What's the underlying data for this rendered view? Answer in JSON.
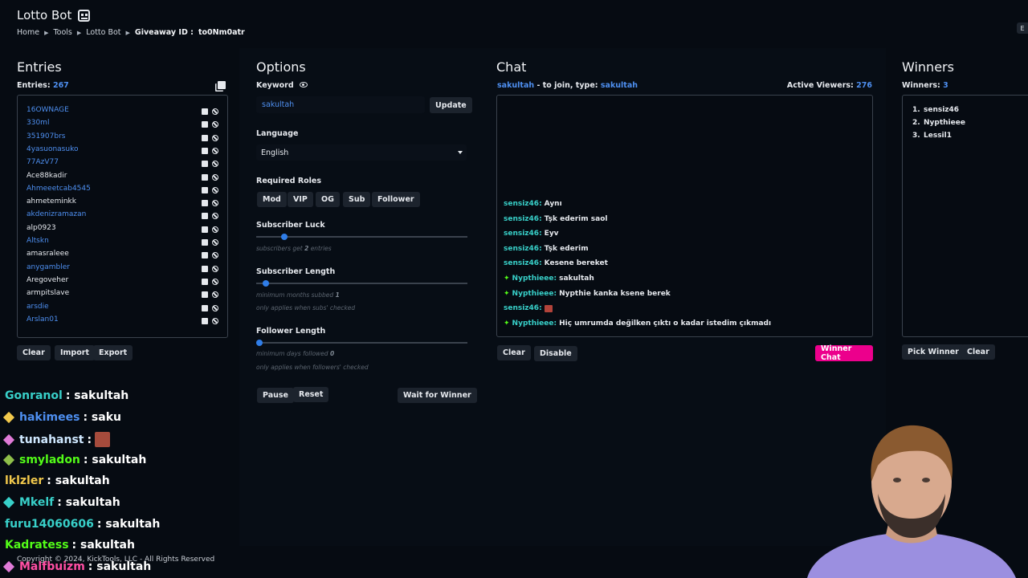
{
  "header": {
    "app_title": "Lotto Bot",
    "breadcrumb": [
      "Home",
      "Tools",
      "Lotto Bot"
    ],
    "giveaway_label": "Giveaway ID :",
    "giveaway_id": "to0Nm0atr",
    "corner_label": "E"
  },
  "entries": {
    "title": "Entries",
    "count_label": "Entries:",
    "count": "267",
    "items": [
      {
        "name": "16OWNAGE",
        "color": "#4e8ff0"
      },
      {
        "name": "330ml",
        "color": "#4e8ff0"
      },
      {
        "name": "351907brs",
        "color": "#4e8ff0"
      },
      {
        "name": "4yasuonasuko",
        "color": "#4e8ff0"
      },
      {
        "name": "77AzV77",
        "color": "#4e8ff0"
      },
      {
        "name": "Ace88kadir",
        "color": "#e6e9ee"
      },
      {
        "name": "Ahmeeetcab4545",
        "color": "#4e8ff0"
      },
      {
        "name": "ahmeteminkk",
        "color": "#e6e9ee"
      },
      {
        "name": "akdenizramazan",
        "color": "#4e8ff0"
      },
      {
        "name": "alp0923",
        "color": "#e6e9ee"
      },
      {
        "name": "Altskn",
        "color": "#4e8ff0"
      },
      {
        "name": "amasraleee",
        "color": "#e6e9ee"
      },
      {
        "name": "anygambler",
        "color": "#4e8ff0"
      },
      {
        "name": "Aregoveher",
        "color": "#e6e9ee"
      },
      {
        "name": "armpitslave",
        "color": "#e6e9ee"
      },
      {
        "name": "arsdie",
        "color": "#4e8ff0"
      },
      {
        "name": "Arslan01",
        "color": "#4e8ff0"
      }
    ],
    "buttons": {
      "clear": "Clear",
      "import": "Import",
      "export": "Export"
    }
  },
  "options": {
    "title": "Options",
    "keyword_label": "Keyword",
    "keyword_value": "sakultah",
    "update_label": "Update",
    "language_label": "Language",
    "language_value": "English",
    "roles_label": "Required Roles",
    "roles": [
      "Mod",
      "VIP",
      "OG",
      "Sub",
      "Follower"
    ],
    "sub_luck_label": "Subscriber Luck",
    "sub_luck_hint_pre": "subscribers get",
    "sub_luck_hint_value": "2",
    "sub_luck_hint_post": "entries",
    "sub_luck_level": 0.12,
    "sub_length_label": "Subscriber Length",
    "sub_length_hint_pre": "minimum months subbed",
    "sub_length_hint_value": "1",
    "sub_length_hint2": "only applies when subs' checked",
    "sub_length_level": 0.03,
    "follower_length_label": "Follower Length",
    "follower_length_hint_pre": "minimum days followed",
    "follower_length_hint_value": "0",
    "follower_length_hint2": "only applies when followers' checked",
    "follower_length_level": 0,
    "buttons": {
      "pause": "Pause",
      "reset": "Reset",
      "wait": "Wait for Winner"
    }
  },
  "chat": {
    "title": "Chat",
    "join_user": "sakultah",
    "join_text": "- to join, type:",
    "join_keyword": "sakultah",
    "viewers_label": "Active Viewers:",
    "viewers_count": "276",
    "messages": [
      {
        "badge": false,
        "user": "sensiz46:",
        "text": "Aynı",
        "emote": false
      },
      {
        "badge": false,
        "user": "sensiz46:",
        "text": "Tşk ederim saol",
        "emote": false
      },
      {
        "badge": false,
        "user": "sensiz46:",
        "text": "Eyv",
        "emote": false
      },
      {
        "badge": false,
        "user": "sensiz46:",
        "text": "Tşk ederim",
        "emote": false
      },
      {
        "badge": false,
        "user": "sensiz46:",
        "text": "Kesene bereket",
        "emote": false
      },
      {
        "badge": true,
        "user": "Nypthieee:",
        "text": "sakultah",
        "emote": false
      },
      {
        "badge": true,
        "user": "Nypthieee:",
        "text": "Nypthie kanka ksene berek",
        "emote": false
      },
      {
        "badge": false,
        "user": "sensiz46:",
        "text": "",
        "emote": true
      },
      {
        "badge": true,
        "user": "Nypthieee:",
        "text": "Hiç umrumda değilken çıktı o kadar istedim çıkmadı",
        "emote": false
      }
    ],
    "buttons": {
      "clear": "Clear",
      "disable": "Disable",
      "winner_chat": "Winner Chat"
    }
  },
  "winners": {
    "title": "Winners",
    "count_label": "Winners:",
    "count": "3",
    "items": [
      "sensiz46",
      "Nypthieee",
      "Lessil1"
    ],
    "buttons": {
      "pick": "Pick Winner",
      "clear": "Clear"
    }
  },
  "overlay_chat": [
    {
      "user": "Gonranol",
      "text": ": sakultah",
      "user_color": "#38d0c9",
      "badge_color": "",
      "emote": false
    },
    {
      "user": "hakimees",
      "text": ": saku",
      "user_color": "#4e8ff0",
      "badge_color": "#f2c94c",
      "emote": false
    },
    {
      "user": "tunahanst",
      "text": ":",
      "user_color": "#cfe8ff",
      "badge_color": "#e07bd8",
      "emote": true
    },
    {
      "user": "smyladon",
      "text": ": sakultah",
      "user_color": "#53fc18",
      "badge_color": "#8fbf4a",
      "emote": false
    },
    {
      "user": "lklzler",
      "text": ": sakultah",
      "user_color": "#f2c94c",
      "badge_color": "",
      "emote": false
    },
    {
      "user": "Mkelf",
      "text": ": sakultah",
      "user_color": "#38d0c9",
      "badge_color": "#38d0c9",
      "emote": false
    },
    {
      "user": "furu14060606",
      "text": ": sakultah",
      "user_color": "#38d0c9",
      "badge_color": "",
      "emote": false
    },
    {
      "user": "Kadratess",
      "text": ": sakultah",
      "user_color": "#53fc18",
      "badge_color": "",
      "emote": false
    },
    {
      "user": "Malfbuizm",
      "text": ": sakultah",
      "user_color": "#ff4fa3",
      "badge_color": "#e07bd8",
      "emote": false
    }
  ],
  "footer": {
    "copyright": "Copyright © 2024, KickTools, LLC - All Rights Reserved"
  },
  "colors": {
    "accent": "#4e8ff0",
    "winner_chat": "#ec008c",
    "chat_user": "#38d0c9",
    "kick_green": "#53fc18"
  }
}
